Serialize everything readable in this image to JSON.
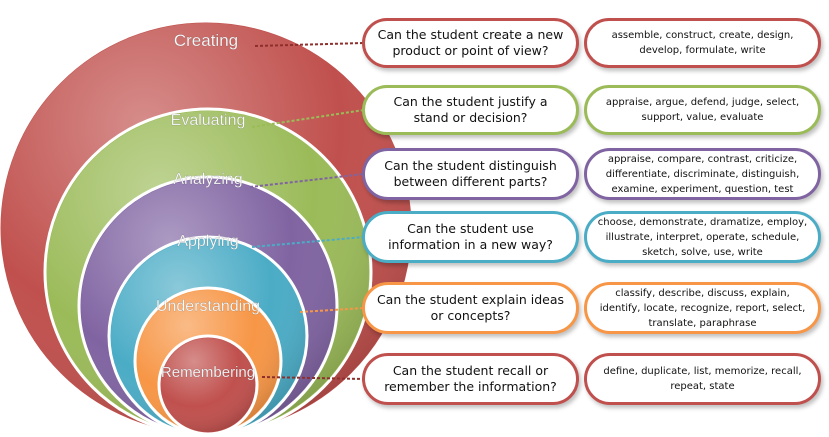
{
  "colors": {
    "creating": "#c0504d",
    "evaluating": "#9bbb59",
    "analyzing": "#8064a2",
    "applying": "#4bacc6",
    "understanding": "#f79646",
    "remembering": "#c0504d"
  },
  "levels": [
    {
      "key": "creating",
      "title": "Creating",
      "question": "Can the student create a new product or point of view?",
      "verbs": "assemble, construct, create, design, develop, formulate, write"
    },
    {
      "key": "evaluating",
      "title": "Evaluating",
      "question": "Can the student justify a stand or decision?",
      "verbs": "appraise, argue, defend, judge, select, support, value, evaluate"
    },
    {
      "key": "analyzing",
      "title": "Analyzing",
      "question": "Can the student distinguish between different parts?",
      "verbs": "appraise, compare, contrast, criticize, differentiate, discriminate, distinguish, examine, experiment, question, test"
    },
    {
      "key": "applying",
      "title": "Applying",
      "question": "Can the student use information in a new way?",
      "verbs": "choose, demonstrate, dramatize, employ, illustrate, interpret, operate, schedule, sketch, solve, use, write"
    },
    {
      "key": "understanding",
      "title": "Understanding",
      "question": "Can the student explain ideas or concepts?",
      "verbs": "classify, describe, discuss, explain, identify, locate, recognize, report, select, translate, paraphrase"
    },
    {
      "key": "remembering",
      "title": "Remembering",
      "question": "Can the student recall or remember the information?",
      "verbs": "define, duplicate, list, memorize, recall, repeat, state"
    }
  ]
}
